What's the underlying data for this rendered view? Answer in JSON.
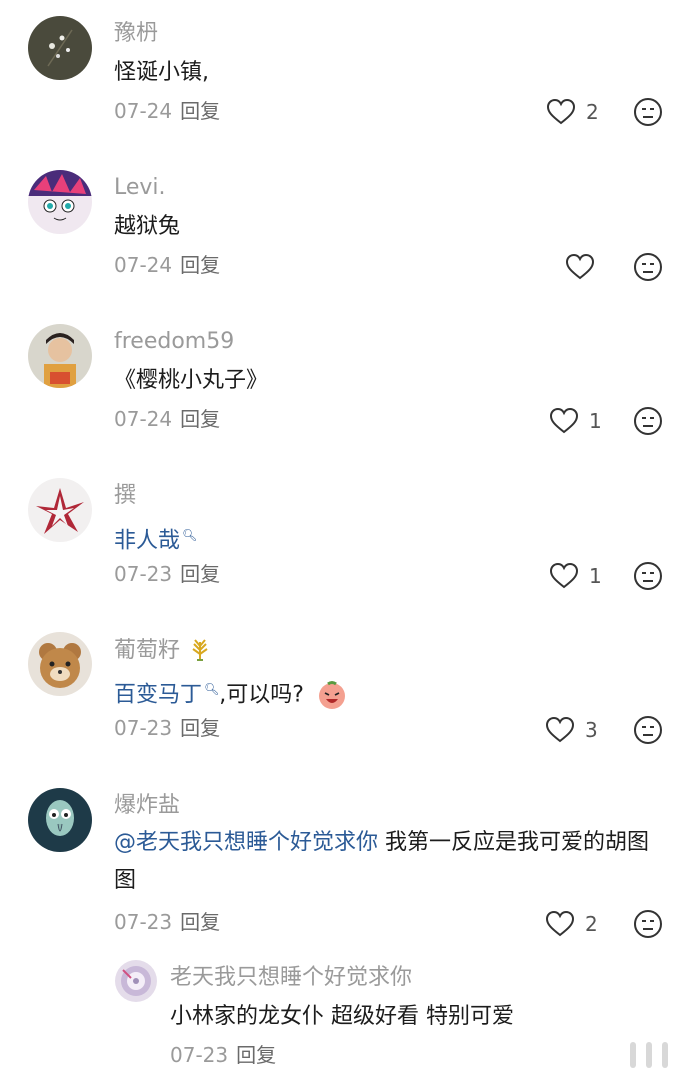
{
  "comments": [
    {
      "user": "豫枬",
      "text": "怪诞小镇,",
      "date": "07-24",
      "reply": "回复",
      "likes": "2"
    },
    {
      "user": "Levi.",
      "text": "越狱兔",
      "date": "07-24",
      "reply": "回复",
      "likes": ""
    },
    {
      "user": "freedom59",
      "text": "《樱桃小丸子》",
      "date": "07-24",
      "reply": "回复",
      "likes": "1"
    },
    {
      "user": "撰",
      "text": "非人哉",
      "date": "07-23",
      "reply": "回复",
      "likes": "1"
    },
    {
      "user": "葡萄籽",
      "text_link": "百变马丁",
      "text_rest": ",可以吗?",
      "date": "07-23",
      "reply": "回复",
      "likes": "3"
    },
    {
      "user": "爆炸盐",
      "mention": "@老天我只想睡个好觉求你",
      "text_rest": " 我第一反应是我可爱的胡图图",
      "date": "07-23",
      "reply": "回复",
      "likes": "2"
    }
  ],
  "sub_reply": {
    "user": "老天我只想睡个好觉求你",
    "text": "小林家的龙女仆 超级好看 特别可爱",
    "date": "07-23",
    "reply": "回复"
  },
  "colors": {
    "username": "#9a9a9a",
    "link": "#2b5a96",
    "text": "#1c1c1c"
  }
}
